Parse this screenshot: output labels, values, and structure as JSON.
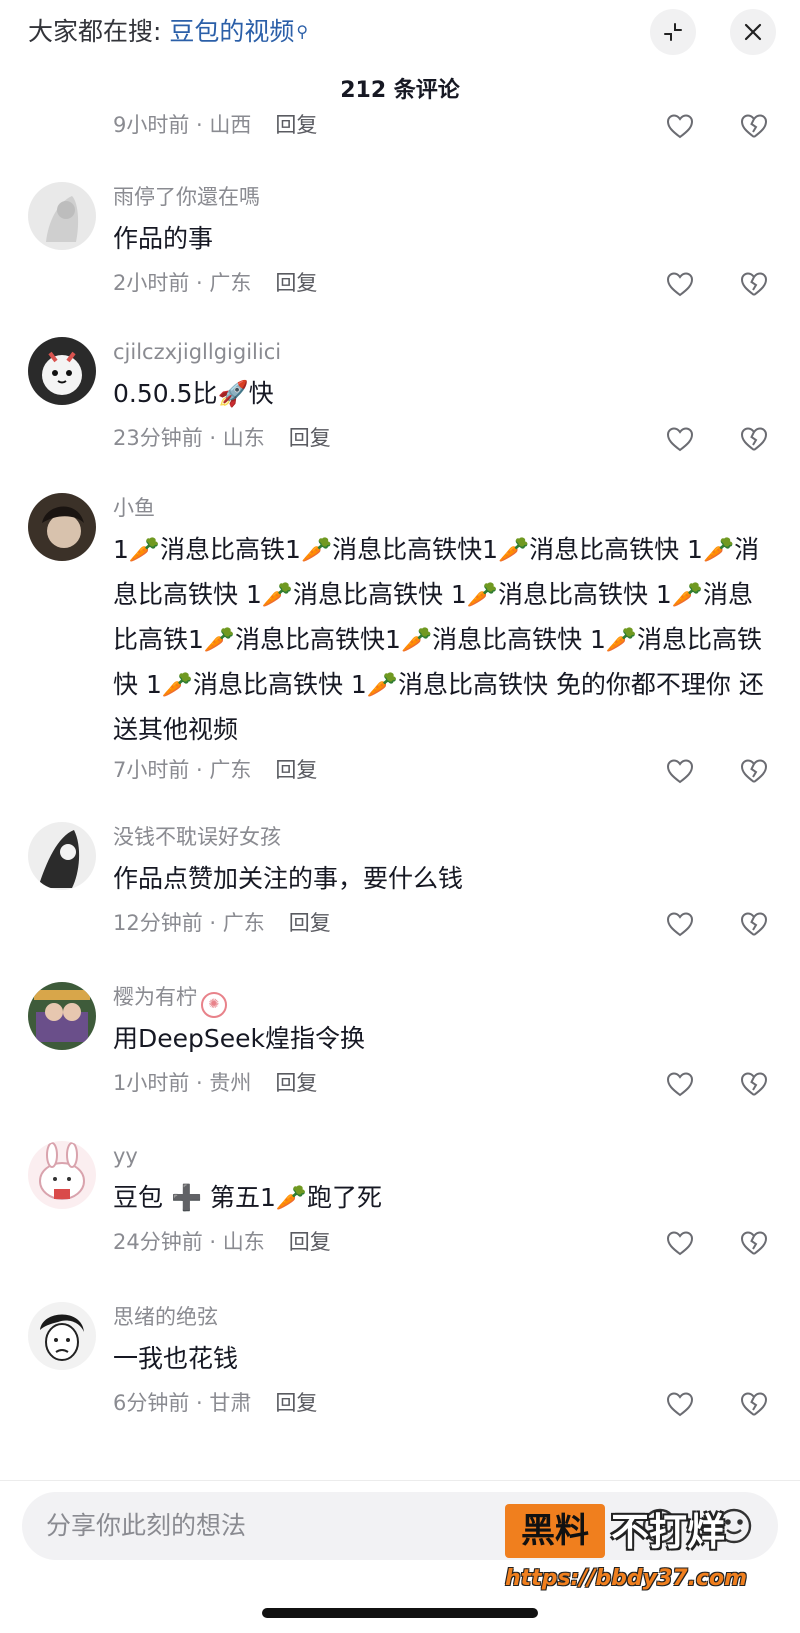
{
  "header": {
    "search_prefix": "大家都在搜:",
    "search_keyword": "豆包的视频",
    "comment_count": "212 条评论"
  },
  "partial_comment": {
    "meta": "9小时前 · 山西",
    "reply": "回复"
  },
  "comments": [
    {
      "username": "雨停了你還在嗎",
      "text": "作品的事",
      "meta": "2小时前 · 广东",
      "reply": "回复"
    },
    {
      "username": "cjilczxjigllgigilici",
      "text": "0.50.5比🚀快",
      "meta": "23分钟前 · 山东",
      "reply": "回复"
    },
    {
      "username": "小鱼",
      "text": "1🥕消息比高铁1🥕消息比高铁快1🥕消息比高铁快 1🥕消息比高铁快 1🥕消息比高铁快 1🥕消息比高铁快 1🥕消息比高铁1🥕消息比高铁快1🥕消息比高铁快 1🥕消息比高铁快 1🥕消息比高铁快 1🥕消息比高铁快 免的你都不理你 还送其他视频",
      "meta": "7小时前 · 广东",
      "reply": "回复"
    },
    {
      "username": "没钱不耽误好女孩",
      "text": "作品点赞加关注的事，要什么钱",
      "meta": "12分钟前 · 广东",
      "reply": "回复"
    },
    {
      "username": "樱为有柠",
      "text": "用DeepSeek煌指令换",
      "meta": "1小时前 · 贵州",
      "reply": "回复"
    },
    {
      "username": "yy",
      "text": "豆包 ➕ 第五1🥕跑了死",
      "meta": "24分钟前 · 山东",
      "reply": "回复"
    },
    {
      "username": "思绪的绝弦",
      "text": "一我也花钱",
      "meta": "6分钟前 · 甘肃",
      "reply": "回复"
    }
  ],
  "input": {
    "placeholder": "分享你此刻的想法"
  },
  "watermark": {
    "box": "黑料",
    "text": "不打烊",
    "url": "https://bbdy37.com"
  },
  "icons": [
    "collapse-icon",
    "close-icon",
    "heart-icon",
    "broken-heart-icon",
    "at-icon",
    "smile-icon"
  ]
}
